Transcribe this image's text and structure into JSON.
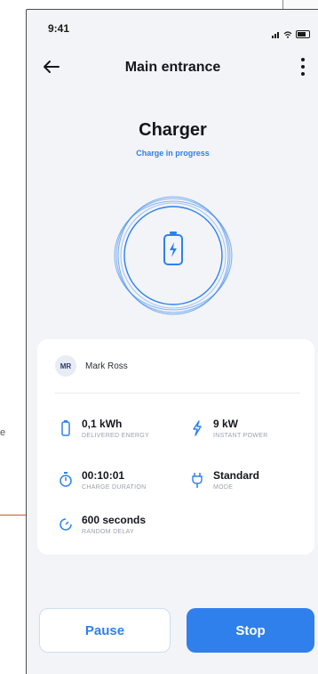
{
  "status_bar": {
    "time": "9:41"
  },
  "header": {
    "title": "Main entrance"
  },
  "charger": {
    "title": "Charger",
    "status": "Charge in progress"
  },
  "session": {
    "user_initials": "MR",
    "user_name": "Mark Ross",
    "metrics": [
      {
        "value": "0,1 kWh",
        "label": "DELIVERED ENERGY",
        "icon": "battery-icon"
      },
      {
        "value": "9 kW",
        "label": "INSTANT POWER",
        "icon": "lightning-icon"
      },
      {
        "value": "00:10:01",
        "label": "CHARGE DURATION",
        "icon": "stopwatch-icon"
      },
      {
        "value": "Standard",
        "label": "MODE",
        "icon": "plug-icon"
      },
      {
        "value": "600 seconds",
        "label": "RANDOM DELAY",
        "icon": "timer-icon"
      }
    ]
  },
  "actions": {
    "pause_label": "Pause",
    "stop_label": "Stop"
  },
  "annotation": {
    "letter": "e"
  },
  "colors": {
    "accent": "#2f80ed",
    "background": "#f2f4f7",
    "annotation": "#c65a2b"
  }
}
